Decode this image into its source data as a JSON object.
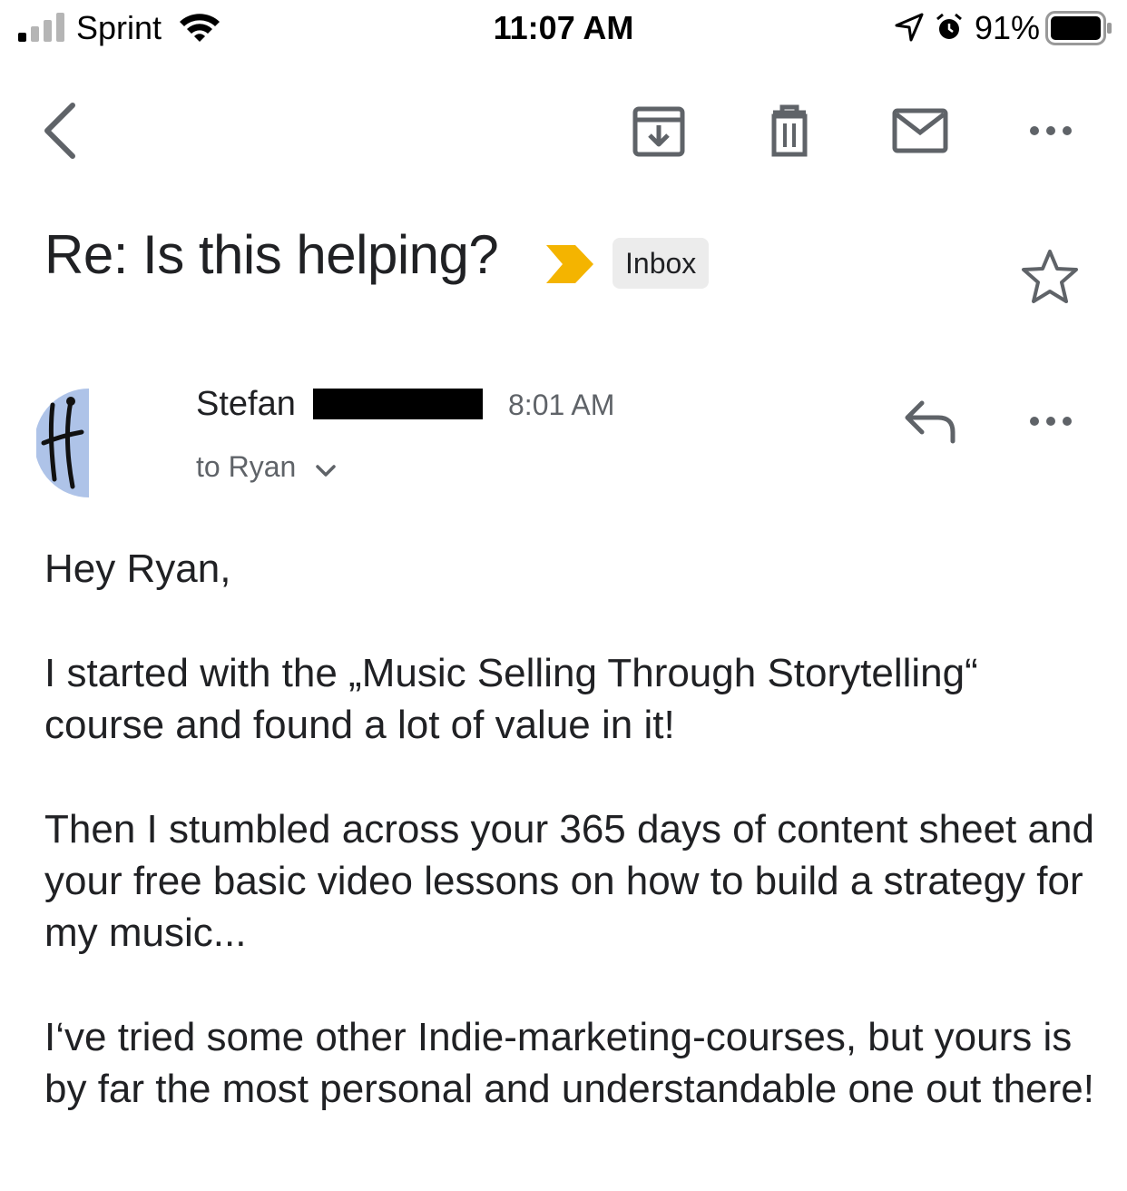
{
  "status_bar": {
    "carrier": "Sprint",
    "time": "11:07 AM",
    "battery_percent": "91%",
    "icons": [
      "signal-icon",
      "wifi-icon",
      "location-arrow-icon",
      "alarm-icon",
      "battery-icon"
    ]
  },
  "toolbar": {
    "icons": [
      "back-arrow-icon",
      "archive-icon",
      "trash-icon",
      "mail-unread-icon",
      "more-icon"
    ]
  },
  "email": {
    "subject": "Re: Is this helping?",
    "label": "Inbox",
    "important_color": "#f4b400",
    "sender": {
      "name": "Stefan",
      "time": "8:01 AM",
      "recipient": "to Ryan"
    },
    "body": [
      "Hey Ryan,",
      "I started with the „Music Selling Through Storytelling“ course and found a lot of value in it!",
      "Then I stumbled across your 365 days of content sheet and your free basic video lessons on how to build a strategy for my music...",
      "I‘ve tried some other Indie-marketing-courses, but yours is by far the most personal and understandable one out there!"
    ]
  }
}
